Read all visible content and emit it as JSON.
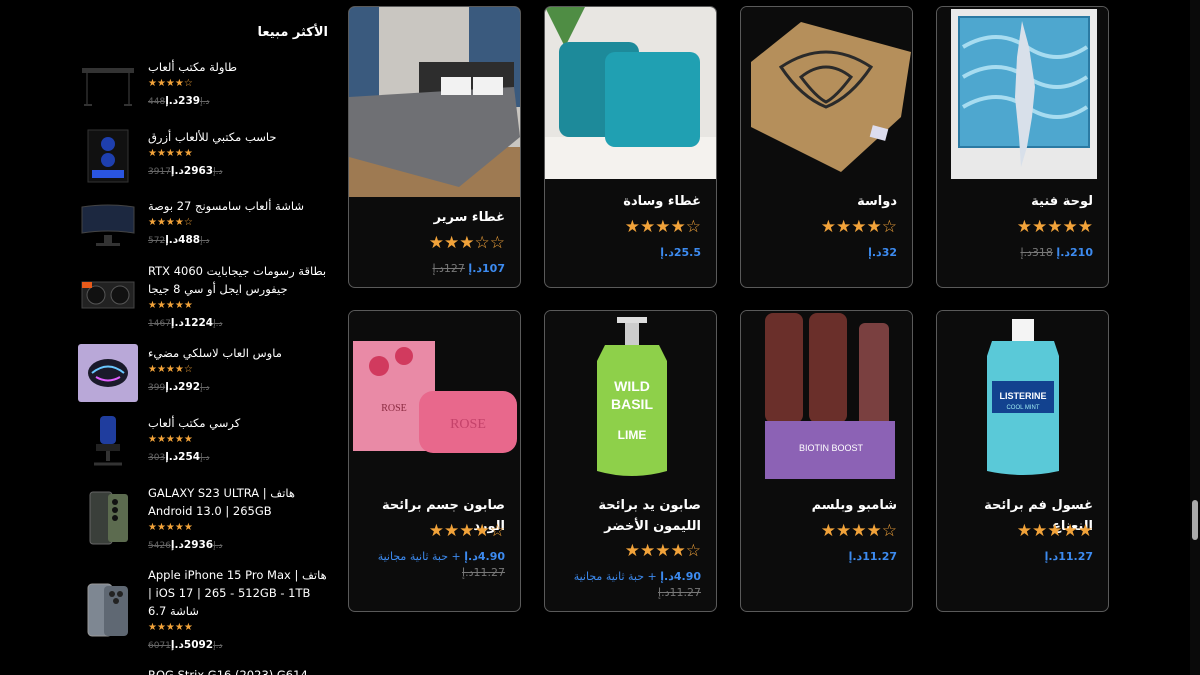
{
  "sidebar": {
    "title": "الأكثر مبيعا",
    "items": [
      {
        "name": "طاولة مكتب ألعاب",
        "stars": "★★★★☆",
        "old_price": "448د.إ",
        "price": "239د.إ"
      },
      {
        "name": "حاسب مكتبي للألعاب أزرق",
        "stars": "★★★★★",
        "old_price": "3917د.إ",
        "price": "2963د.إ"
      },
      {
        "name": "شاشة ألعاب سامسونج 27 بوصة",
        "stars": "★★★★☆",
        "old_price": "572د.إ",
        "price": "488د.إ"
      },
      {
        "name": "بطاقة رسومات جيجابايت RTX 4060 جيفورس ايجل أو سي 8 جيجا",
        "stars": "★★★★★",
        "old_price": "1467د.إ",
        "price": "1224د.إ"
      },
      {
        "name": "ماوس العاب لاسلكي مضيء",
        "stars": "★★★★☆",
        "old_price": "399د.إ",
        "price": "292د.إ"
      },
      {
        "name": "كرسي مكتب ألعاب",
        "stars": "★★★★★",
        "old_price": "303د.إ",
        "price": "254د.إ"
      },
      {
        "name": "هاتف GALAXY S23 ULTRA | Android 13.0 | 265GB",
        "stars": "★★★★★",
        "old_price": "5426د.إ",
        "price": "2936د.إ"
      },
      {
        "name": "هاتف Apple iPhone 15 Pro Max | iOS 17 | 265 - 512GB - 1TB | شاشة 6.7",
        "stars": "★★★★★",
        "old_price": "6071د.إ",
        "price": "5092د.إ"
      },
      {
        "name": "ROG Strix G16 (2023) G614"
      }
    ]
  },
  "products": [
    {
      "title": "لوحة فنية",
      "stars": "★★★★★",
      "old_price": "318د.إ",
      "price": "210د.إ"
    },
    {
      "title": "دواسة",
      "stars": "★★★★☆",
      "price": "32د.إ"
    },
    {
      "title": "غطاء وسادة",
      "stars": "★★★★☆",
      "price": "25.5د.إ"
    },
    {
      "title": "غطاء سرير",
      "stars": "★★★☆☆",
      "old_price": "127د.إ",
      "price": "107د.إ"
    },
    {
      "title": "غسول فم برائحة النعناع",
      "stars": "★★★★★",
      "price": "11.27د.إ"
    },
    {
      "title": "شامبو وبلسم",
      "stars": "★★★★☆",
      "price": "11.27د.إ"
    },
    {
      "title": "صابون يد برائحة الليمون الأخضر",
      "stars": "★★★★☆",
      "old_price": "11.27د.إ",
      "price": "4.90د.إ",
      "offer": "+ حبة ثانية مجانية"
    },
    {
      "title": "صابون جسم برائحة الورد",
      "stars": "★★★★☆",
      "old_price": "11.27د.إ",
      "price": "4.90د.إ",
      "offer": "+ حبة ثانية مجانية"
    }
  ],
  "colors": {
    "accent": "#3d8bf0",
    "star": "#f2a33a",
    "card_border": "#5a5a5a"
  }
}
